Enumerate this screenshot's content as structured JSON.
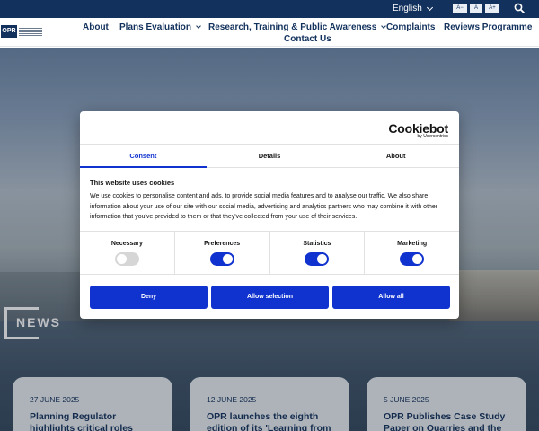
{
  "topbar": {
    "language": "English",
    "font_size_buttons": [
      "A−",
      "A",
      "A+"
    ]
  },
  "nav": {
    "logo_text": "OPR",
    "items": [
      {
        "label": "About",
        "has_dropdown": false
      },
      {
        "label": "Plans Evaluation",
        "has_dropdown": true
      },
      {
        "label": "Research, Training & Public Awareness",
        "has_dropdown": true
      },
      {
        "label": "Complaints",
        "has_dropdown": false
      },
      {
        "label": "Reviews Programme",
        "has_dropdown": false
      }
    ],
    "contact": "Contact Us"
  },
  "hero": {
    "news_label": "NEWS"
  },
  "news": [
    {
      "date": "27 JUNE 2025",
      "title": "Planning Regulator highlights critical roles played by"
    },
    {
      "date": "12 JUNE 2025",
      "title": "OPR launches the eighth edition of its 'Learning from"
    },
    {
      "date": "5 JUNE 2025",
      "title": "OPR Publishes Case Study Paper on Quarries and the"
    }
  ],
  "cookie": {
    "brand": "Cookiebot",
    "brand_sub": "by Usercentrics",
    "tabs": [
      "Consent",
      "Details",
      "About"
    ],
    "active_tab": "Consent",
    "heading": "This website uses cookies",
    "body": "We use cookies to personalise content and ads, to provide social media features and to analyse our traffic. We also share information about your use of our site with our social media, advertising and analytics partners who may combine it with other information that you've provided to them or that they've collected from your use of their services.",
    "categories": [
      {
        "name": "Necessary",
        "enabled": false
      },
      {
        "name": "Preferences",
        "enabled": true
      },
      {
        "name": "Statistics",
        "enabled": true
      },
      {
        "name": "Marketing",
        "enabled": true
      }
    ],
    "buttons": {
      "deny": "Deny",
      "allow_selection": "Allow selection",
      "allow_all": "Allow all"
    }
  },
  "colors": {
    "navy": "#12315c",
    "cookie_blue": "#1032cf"
  }
}
